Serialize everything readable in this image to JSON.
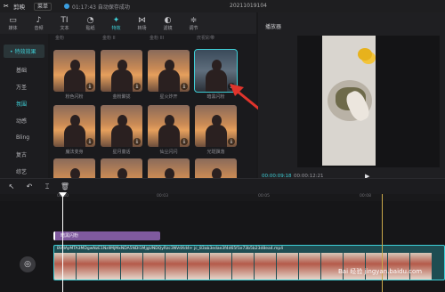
{
  "titlebar": {
    "app_name": "剪映",
    "menu_label": "菜单",
    "status_text": "01:17:43 自动保存成功",
    "project_name": "20211019104"
  },
  "toolbar": {
    "items": [
      {
        "icon": "media-icon",
        "glyph": "▭",
        "label": "媒体"
      },
      {
        "icon": "audio-icon",
        "glyph": "♪",
        "label": "音频"
      },
      {
        "icon": "text-icon",
        "glyph": "TI",
        "label": "文本"
      },
      {
        "icon": "sticker-icon",
        "glyph": "◔",
        "label": "贴纸"
      },
      {
        "icon": "effects-icon",
        "glyph": "✦",
        "label": "特效",
        "active": true
      },
      {
        "icon": "transition-icon",
        "glyph": "⋈",
        "label": "转场"
      },
      {
        "icon": "filter-icon",
        "glyph": "◐",
        "label": "滤镜"
      },
      {
        "icon": "adjust-icon",
        "glyph": "≑",
        "label": "调节"
      }
    ]
  },
  "categories": {
    "header": "• 特效效果",
    "items": [
      "基础",
      "万圣",
      "氛围",
      "动感",
      "Bling",
      "复古",
      "综艺"
    ],
    "selected_index": 2
  },
  "effects_grid": {
    "column_headers": [
      "金粉",
      "金粉 II",
      "金粉 III",
      "庆祝彩带"
    ],
    "rows": [
      [
        "粉色闪粉",
        "金粉聚拢",
        "星火炸开",
        "暗黑闪粉"
      ],
      [
        "魔法变身",
        "星月童话",
        "仙尘闪闪",
        "光斑飘落"
      ]
    ],
    "selected": "暗黑闪粉"
  },
  "player": {
    "title": "播放器",
    "current_time": "00:00:09:18",
    "total_time": "00:00:12:21"
  },
  "timeline": {
    "ruler": [
      "00:00",
      "00:03",
      "00:05",
      "00:08",
      "00:10"
    ],
    "effect_clip_label": "暗黑闪粉",
    "video_clip_name": "BVdAyMTA3MDgwNzE1NzIlMjMxNDA5NDI1MjgUNDQyRzc3NVdXd4+ jc_83ab3edae3f4d65f1e73b5b23d8ea4.mp4",
    "main_track_icon": "◎"
  },
  "colors": {
    "accent": "#3fd0d8",
    "effect_clip": "#7f5a9e",
    "video_clip": "#1e4d52",
    "arrow": "#e0342c"
  },
  "watermark": "Bai 经验 jingyan.baidu.com"
}
